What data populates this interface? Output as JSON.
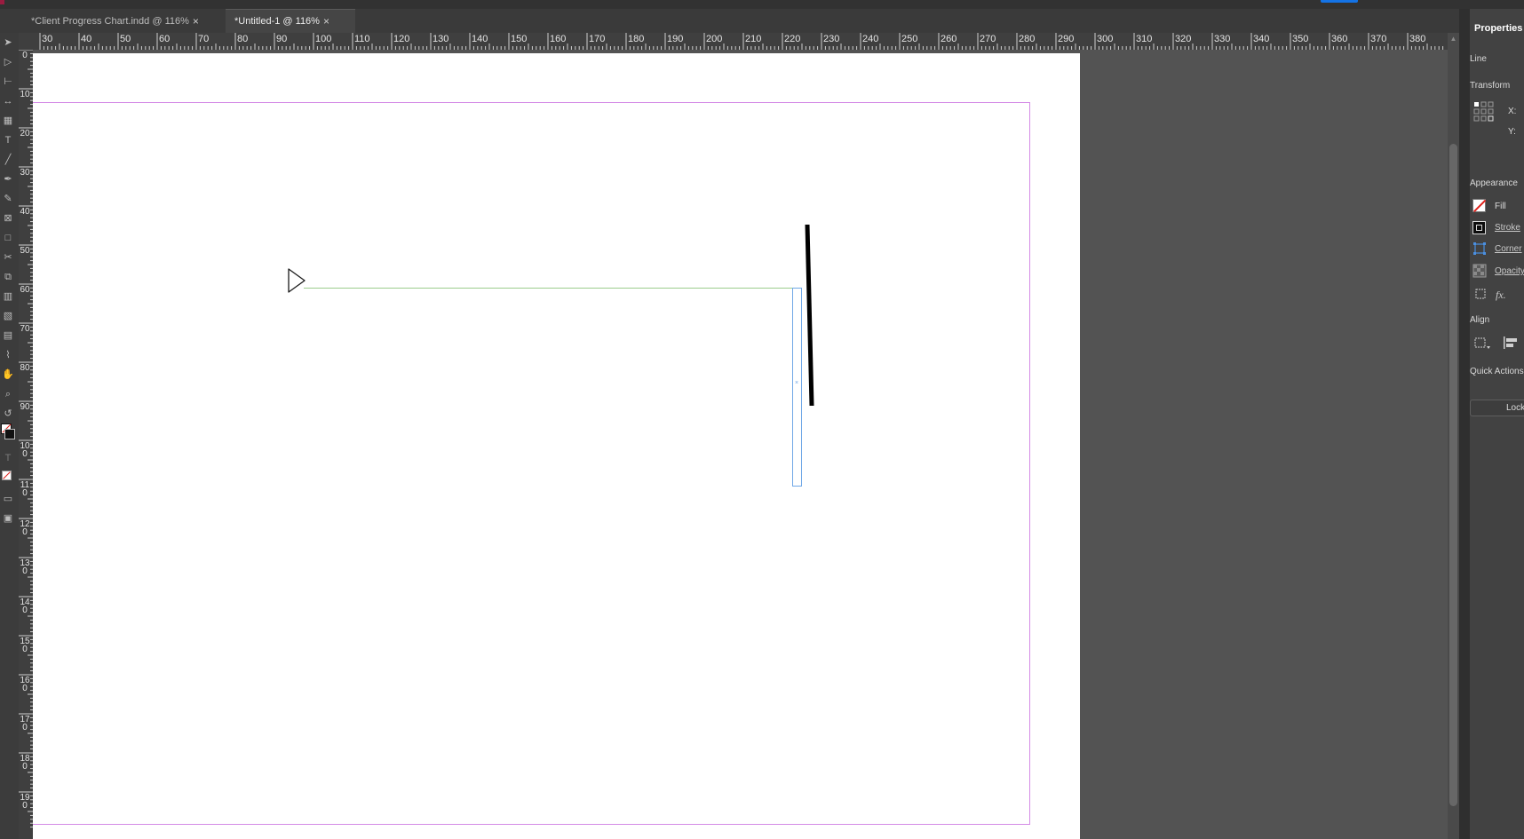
{
  "tabs": [
    {
      "label": "*Client Progress Chart.indd @ 116%",
      "close": "×",
      "active": false
    },
    {
      "label": "*Untitled-1 @ 116%",
      "close": "×",
      "active": true
    }
  ],
  "rulers": {
    "horizontal": [
      "30",
      "40",
      "50",
      "60",
      "70",
      "80",
      "90",
      "100",
      "110",
      "120",
      "130",
      "140",
      "150",
      "160",
      "170",
      "180",
      "190",
      "200",
      "210",
      "220",
      "230",
      "240",
      "250",
      "260",
      "270",
      "280",
      "290",
      "300",
      "310",
      "320",
      "330",
      "340",
      "350",
      "360",
      "370",
      "380"
    ],
    "vertical": [
      "0",
      "10",
      "20",
      "30",
      "40",
      "50",
      "60",
      "70",
      "80",
      "90",
      "100",
      "110",
      "120",
      "130",
      "140",
      "150",
      "160",
      "170",
      "180",
      "190"
    ]
  },
  "properties": {
    "title": "Properties",
    "selection_type": "Line",
    "transform": {
      "heading": "Transform",
      "x_label": "X:",
      "y_label": "Y:"
    },
    "appearance": {
      "heading": "Appearance",
      "fill": "Fill",
      "stroke": "Stroke",
      "corner": "Corner",
      "opacity": "Opacity",
      "fx": "fx."
    },
    "align": {
      "heading": "Align"
    },
    "quick_actions": {
      "heading": "Quick Actions",
      "lock": "Lock"
    }
  },
  "colors": {
    "margin_guide": "#d48ae6",
    "frame_edge": "#6fa7e6",
    "path_line": "#9ccc8c",
    "stroke": "#000000",
    "brand": "#9a1c40",
    "accent": "#1473e6"
  }
}
